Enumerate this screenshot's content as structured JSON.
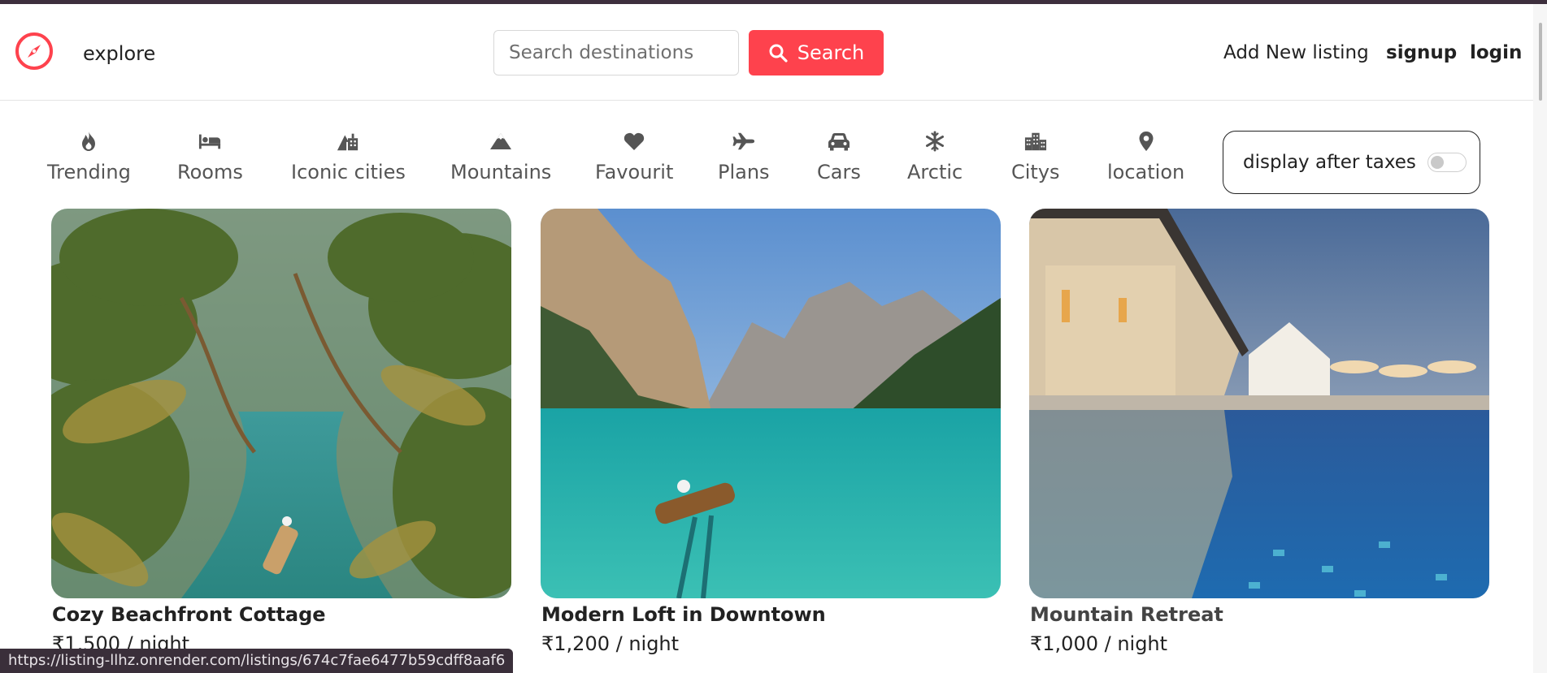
{
  "navbar": {
    "brand_label": "explore",
    "search": {
      "placeholder": "Search destinations",
      "value": ""
    },
    "search_button_label": "Search",
    "add_listing_label": "Add New listing",
    "signup_label": "signup",
    "login_label": "login"
  },
  "filters": [
    {
      "label": "Trending",
      "icon": "fire-icon"
    },
    {
      "label": "Rooms",
      "icon": "bed-icon"
    },
    {
      "label": "Iconic cities",
      "icon": "mountain-city-icon"
    },
    {
      "label": "Mountains",
      "icon": "mountain-icon"
    },
    {
      "label": "Favourit",
      "icon": "heart-icon"
    },
    {
      "label": "Plans",
      "icon": "plane-icon"
    },
    {
      "label": "Cars",
      "icon": "car-icon"
    },
    {
      "label": "Arctic",
      "icon": "snowflake-icon"
    },
    {
      "label": "Citys",
      "icon": "city-icon"
    },
    {
      "label": "location",
      "icon": "location-pin-icon"
    }
  ],
  "tax_toggle": {
    "label": "display after taxes",
    "checked": false
  },
  "listings": [
    {
      "title": "Cozy Beachfront Cottage",
      "price": "₹1,500 / night"
    },
    {
      "title": "Modern Loft in Downtown",
      "price": "₹1,200 / night"
    },
    {
      "title": "Mountain Retreat",
      "price": "₹1,000 / night"
    }
  ],
  "status_bar_url": "https://listing-llhz.onrender.com/listings/674c7fae6477b59cdff8aaf6",
  "colors": {
    "accent": "#fe424d",
    "text": "#222222",
    "muted": "#555555"
  }
}
